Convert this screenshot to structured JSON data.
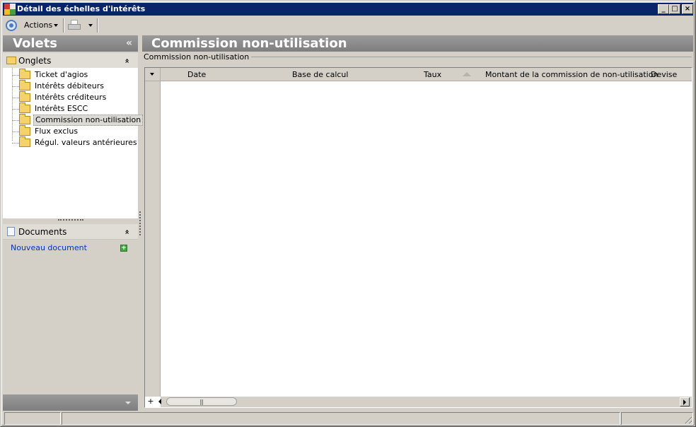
{
  "window": {
    "title": "Détail des échelles d'intérêts",
    "minimize": "_",
    "maximize": "□",
    "close": "×"
  },
  "toolbar": {
    "actions_label": "Actions",
    "nav_icon": "navigation-circle-icon",
    "print_icon": "printer-icon"
  },
  "left_panel": {
    "title": "Volets",
    "collapse_glyph": "«",
    "onglets": {
      "title": "Onglets",
      "chevron": "«",
      "items": [
        {
          "label": "Ticket d'agios",
          "selected": false
        },
        {
          "label": "Intérêts débiteurs",
          "selected": false
        },
        {
          "label": "Intérêts créditeurs",
          "selected": false
        },
        {
          "label": "Intérêts ESCC",
          "selected": false
        },
        {
          "label": "Commission non-utilisation",
          "selected": true
        },
        {
          "label": "Flux exclus",
          "selected": false
        },
        {
          "label": "Régul. valeurs antérieures",
          "selected": false
        }
      ]
    },
    "documents": {
      "title": "Documents",
      "chevron": "«",
      "new_document": "Nouveau document",
      "add_glyph": "+"
    }
  },
  "main": {
    "title": "Commission non-utilisation",
    "group_caption": "Commission non-utilisation",
    "grid": {
      "columns": [
        {
          "label": "Date"
        },
        {
          "label": "Base de calcul"
        },
        {
          "label": "Taux"
        },
        {
          "label": "Montant de la commission de non-utilisation"
        },
        {
          "label": "Devise"
        }
      ],
      "rows": [],
      "add_row_glyph": "+",
      "scroll_grip": "|||"
    }
  },
  "statusbar": {
    "panes": [
      "",
      "",
      ""
    ]
  }
}
